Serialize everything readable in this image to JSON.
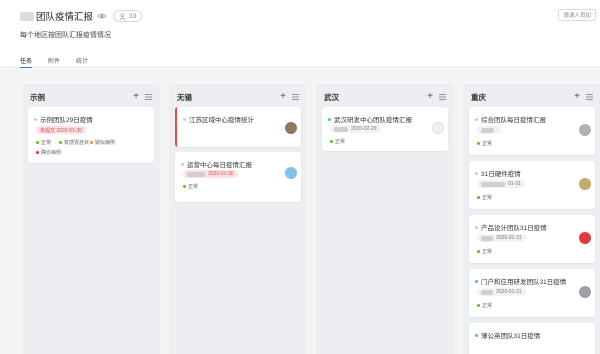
{
  "header": {
    "title": "团队疫情汇报",
    "member_count": "33",
    "subtitle": "每个地区按团队汇报疫情情况",
    "invite_label": "邀请人员加"
  },
  "tabs": [
    {
      "label": "任务",
      "active": true
    },
    {
      "label": "附件",
      "active": false
    },
    {
      "label": "统计",
      "active": false
    }
  ],
  "columns": [
    {
      "title": "示例",
      "cards": [
        {
          "title": "示例团队29日疫情",
          "due": "未提交 2020-01-30",
          "due_status": "overdue",
          "tags": [
            {
              "label": "正常",
              "color": "#52c41a"
            },
            {
              "label": "有感冒症状",
              "color": "#52c41a"
            },
            {
              "label": "疑似病例",
              "color": "#fa8c16"
            },
            {
              "label": "确诊病例",
              "color": "#f5222d"
            }
          ]
        }
      ]
    },
    {
      "title": "无锡",
      "cards": [
        {
          "title": "江苏区域中心疫情统计",
          "due": "",
          "tags": []
        },
        {
          "title": "运营中心每日疫情汇报",
          "due": "2020-01-30",
          "due_status": "overdue",
          "tags": [
            {
              "label": "正常",
              "color": "#52c41a"
            }
          ]
        }
      ]
    },
    {
      "title": "武汉",
      "cards": [
        {
          "title": "武汉研发中心团队疫情汇报",
          "due": "2020-02-29",
          "due_status": "normal",
          "tags": [
            {
              "label": "正常",
              "color": "#52c41a"
            }
          ]
        }
      ]
    },
    {
      "title": "重庆",
      "cards": [
        {
          "title": "综合团队每日疫情汇报",
          "due": "",
          "tags": [
            {
              "label": "正常",
              "color": "#52c41a"
            }
          ]
        },
        {
          "title": "31日硬件疫情",
          "due": "01-31",
          "due_status": "normal",
          "tags": [
            {
              "label": "正常",
              "color": "#52c41a"
            }
          ]
        },
        {
          "title": "产品设计团队31日疫情",
          "due": "2020-01-31",
          "due_status": "normal",
          "tags": [
            {
              "label": "正常",
              "color": "#52c41a"
            }
          ]
        },
        {
          "title": "门户和应用研发团队31日疫情",
          "due": "2020-01-31",
          "due_status": "normal",
          "tags": [
            {
              "label": "正常",
              "color": "#52c41a"
            }
          ]
        },
        {
          "title": "薄公英团队31日疫情",
          "due": "",
          "tags": []
        }
      ]
    }
  ],
  "colors": {
    "accent": "#2b78e4",
    "flag": "#e84b4b",
    "overdue_bg": "#fde2e4",
    "overdue_text": "#d9465b"
  }
}
